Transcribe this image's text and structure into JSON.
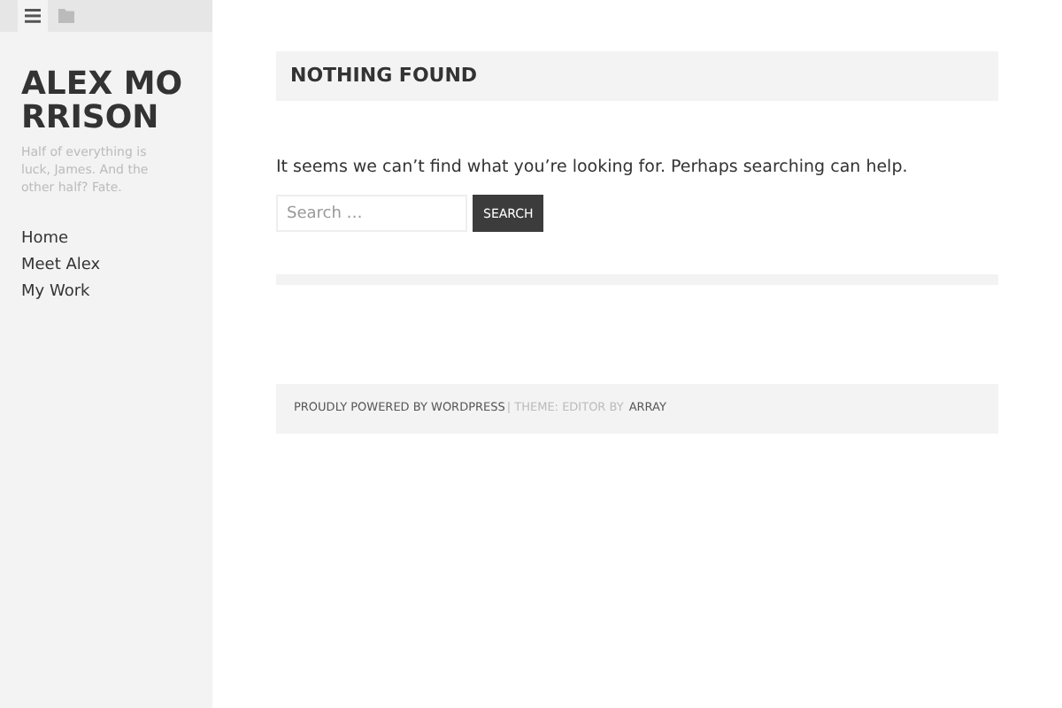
{
  "sidebar": {
    "tabs": [
      {
        "kind": "menu",
        "selected": true
      },
      {
        "kind": "folder",
        "selected": false
      }
    ],
    "site_title": "ALEX MORRISON",
    "tagline": "Half of everything is luck, James. And the other half? Fate.",
    "nav": [
      "Home",
      "Meet Alex",
      "My Work"
    ]
  },
  "main": {
    "title": "NOTHING FOUND",
    "message": "It seems we can’t find what you’re looking for. Perhaps searching can help.",
    "search": {
      "placeholder": "Search …",
      "button": "SEARCH"
    }
  },
  "footer": {
    "powered": "PROUDLY POWERED BY WORDPRESS",
    "theme": "| THEME: EDITOR BY",
    "author": "ARRAY"
  }
}
